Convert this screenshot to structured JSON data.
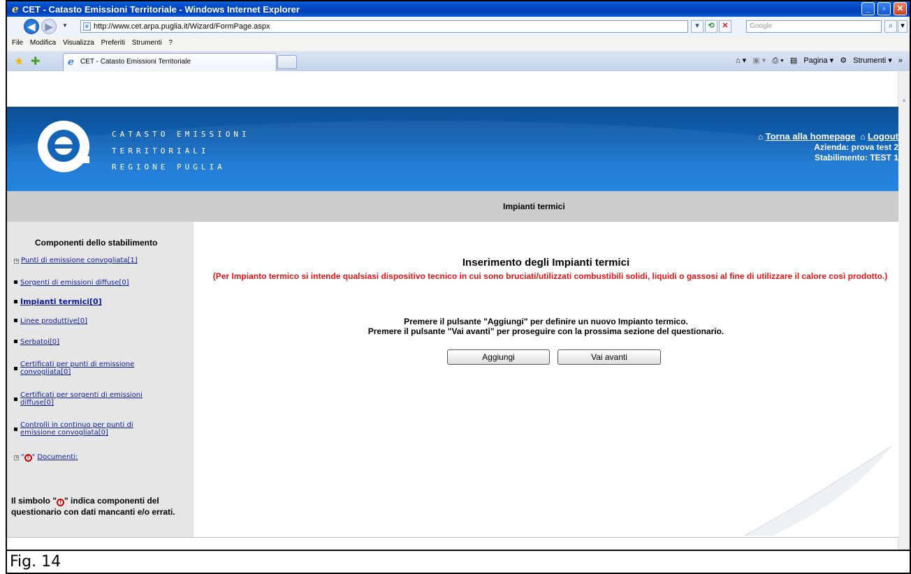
{
  "window": {
    "title": "CET - Catasto Emissioni Territoriale - Windows Internet Explorer",
    "url": "http://www.cet.arpa.puglia.it/Wizard/FormPage.aspx",
    "search_placeholder": "Google"
  },
  "menu": [
    "File",
    "Modifica",
    "Visualizza",
    "Preferiti",
    "Strumenti",
    "?"
  ],
  "tab": {
    "label": "CET - Catasto Emissioni Territoriale"
  },
  "command_bar": {
    "page": "Pagina",
    "tools": "Strumenti"
  },
  "header": {
    "brand_lines": [
      "CATASTO EMISSIONI",
      "TERRITORIALI",
      "REGIONE PUGLIA"
    ],
    "home_link": "Torna alla homepage",
    "logout_link": "Logout",
    "azienda": "Azienda: prova test 2",
    "stabilimento": "Stabilimento: TEST 1"
  },
  "section_title": "Impianti termici",
  "sidebar": {
    "title": "Componenti dello stabilimento",
    "items": [
      {
        "label": "Punti di emissione convogliata[1]",
        "marker": "plus"
      },
      {
        "label": "Sorgenti di emissioni diffuse[0]",
        "marker": "bullet"
      },
      {
        "label": "Impianti termici[0]",
        "marker": "bullet",
        "active": true
      },
      {
        "label": "Linee produttive[0]",
        "marker": "bullet"
      },
      {
        "label": "Serbatoi[0]",
        "marker": "bullet"
      },
      {
        "label": "Certificati per punti di emissione convogliata[0]",
        "marker": "bullet"
      },
      {
        "label": "Certificati per sorgenti di emissioni diffuse[0]",
        "marker": "bullet"
      },
      {
        "label": "Controlli in continuo per punti di emissione convogliata[0]",
        "marker": "bullet"
      },
      {
        "label": "Documenti:",
        "marker": "plus",
        "warning": true
      }
    ],
    "note_prefix": "Il simbolo \"",
    "note_suffix": "\" indica componenti del questionario con dati mancanti e/o errati."
  },
  "main": {
    "heading": "Inserimento degli Impianti termici",
    "definition": "(Per Impianto termico si intende qualsiasi dispositivo tecnico in cui sono bruciati/utilizzati combustibili solidi, liquidi o gassosi al fine di utilizzare il calore così prodotto.)",
    "instruction_1": "Premere il pulsante \"Aggiungi\" per definire un nuovo Impianto termico.",
    "instruction_2": "Premere il pulsante \"Vai avanti\" per proseguire con la prossima sezione del questionario.",
    "add_button": "Aggiungi",
    "next_button": "Vai avanti"
  },
  "caption": "Fig. 14",
  "colors": {
    "titlebar": "#0246c2",
    "banner": "#1464b8",
    "definition_text": "#e31414",
    "link": "#0a1b9a"
  }
}
